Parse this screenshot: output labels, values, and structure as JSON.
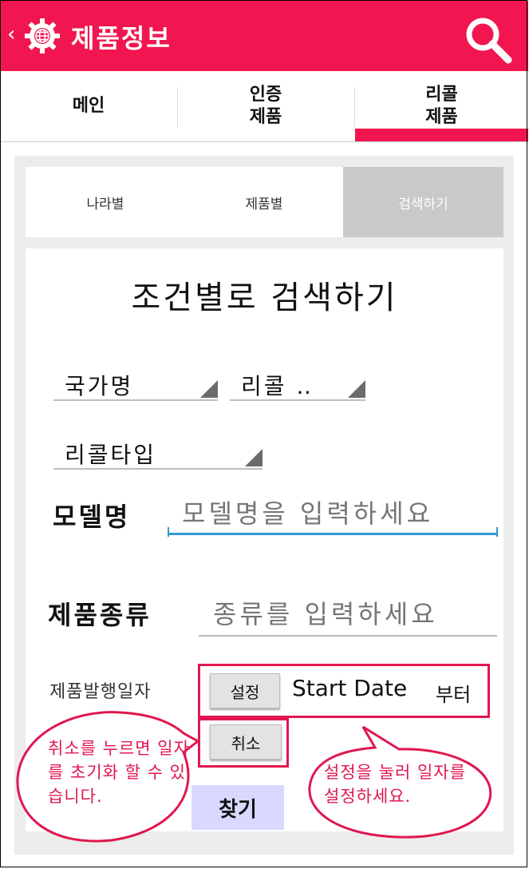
{
  "header": {
    "back_glyph": "‹",
    "title": "제품정보",
    "logo_icon": "globe-gear-icon",
    "search_icon": "search-icon",
    "color": "#f1164f"
  },
  "tabs": [
    {
      "label": "메인",
      "active": false
    },
    {
      "label": "인증\n제품",
      "active": false
    },
    {
      "label": "리콜\n제품",
      "active": true
    }
  ],
  "subtabs": [
    {
      "label": "나라별",
      "active": false
    },
    {
      "label": "제품별",
      "active": false
    },
    {
      "label": "검색하기",
      "active": true
    }
  ],
  "form": {
    "heading": "조건별로 검색하기",
    "country_spinner": "국가명",
    "recall_spinner": "리콜 ‥",
    "recall_type_spinner": "리콜타입",
    "model_label": "모델명",
    "model_placeholder": "모델명을 입력하세요",
    "type_label": "제품종류",
    "type_placeholder": "종류를 입력하세요",
    "date_label": "제품발행일자",
    "set_button": "설정",
    "start_date": "Start Date",
    "start_suffix": "부터",
    "cancel_button": "취소",
    "find_button": "찾기"
  },
  "annotations": {
    "left_bubble": "취소를 누르면 일자를 초기화 할 수 있습니다.",
    "right_bubble": "설정을 눌러 일자를 설정하세요.",
    "color": "#e0174f"
  }
}
